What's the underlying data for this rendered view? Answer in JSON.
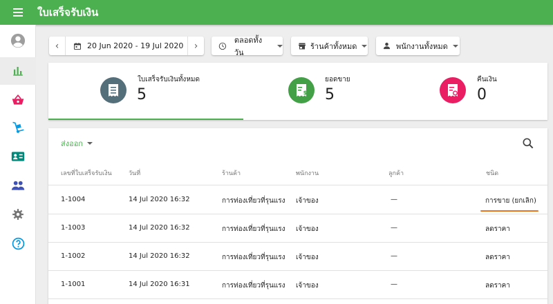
{
  "app": {
    "title": "ใบเสร็จรับเงิน"
  },
  "icons": {
    "menu": "menu-icon",
    "account": "account-circle-icon",
    "chart": "bar-chart-icon",
    "basket": "basket-icon",
    "dolly": "hand-truck-icon",
    "badge": "id-card-icon",
    "people": "people-icon",
    "settings": "gear-icon",
    "help": "help-circle-icon"
  },
  "colors": {
    "brand": "#4caf50",
    "receipts": "#546e7a",
    "sales": "#43a047",
    "refunds": "#e91e63",
    "highlight": "#e8731f"
  },
  "toolbar": {
    "prev_label": "‹",
    "date_range": "20 Jun 2020 - 19 Jul 2020",
    "next_label": "›",
    "time_filter": "ตลอดทั้งวัน",
    "store_filter": "ร้านค้าทั้งหมด",
    "employee_filter": "พนักงานทั้งหมด"
  },
  "summary": [
    {
      "label": "ใบเสร็จรับเงินทั้งหมด",
      "value": "5"
    },
    {
      "label": "ยอดขาย",
      "value": "5"
    },
    {
      "label": "คืนเงิน",
      "value": "0"
    }
  ],
  "table": {
    "export_label": "ส่งออก",
    "headers": [
      "เลขที่ใบเสร็จรับเงิน",
      "วันที่",
      "ร้านค้า",
      "พนักงาน",
      "ลูกค้า",
      "ชนิด"
    ],
    "rows": [
      [
        "1-1004",
        "14 Jul 2020 16:32",
        "การท่องเที่ยวที่รุนแรง",
        "เจ้าของ",
        "—",
        "การขาย (ยกเลิก)"
      ],
      [
        "1-1003",
        "14 Jul 2020 16:32",
        "การท่องเที่ยวที่รุนแรง",
        "เจ้าของ",
        "—",
        "ลดราคา"
      ],
      [
        "1-1002",
        "14 Jul 2020 16:32",
        "การท่องเที่ยวที่รุนแรง",
        "เจ้าของ",
        "—",
        "ลดราคา"
      ],
      [
        "1-1001",
        "14 Jul 2020 16:31",
        "การท่องเที่ยวที่รุนแรง",
        "เจ้าของ",
        "—",
        "ลดราคา"
      ]
    ]
  }
}
